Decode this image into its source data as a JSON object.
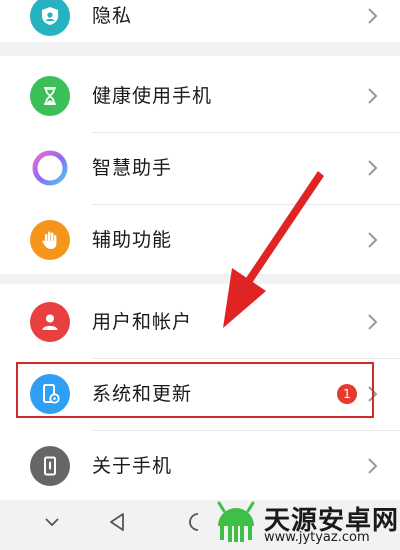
{
  "settings": {
    "items": [
      {
        "label": "隐私",
        "icon": "privacy-shield-icon",
        "color": "#27b2c0"
      },
      {
        "label": "健康使用手机",
        "icon": "hourglass-icon",
        "color": "#3bbf57"
      },
      {
        "label": "智慧助手",
        "icon": "assistant-ring-icon",
        "color": "#8f6bf0"
      },
      {
        "label": "辅助功能",
        "icon": "hand-icon",
        "color": "#f5951c"
      },
      {
        "label": "用户和帐户",
        "icon": "user-icon",
        "color": "#e84040"
      },
      {
        "label": "系统和更新",
        "icon": "phone-settings-icon",
        "color": "#2f9ff3",
        "badge": "1"
      },
      {
        "label": "关于手机",
        "icon": "phone-info-icon",
        "color": "#666666"
      }
    ]
  },
  "watermark": {
    "text": "天源安卓网",
    "url": "www.jytyaz.com"
  },
  "colors": {
    "highlight_box": "#cc2c2c",
    "arrow": "#e02424",
    "badge": "#e53b2e"
  }
}
